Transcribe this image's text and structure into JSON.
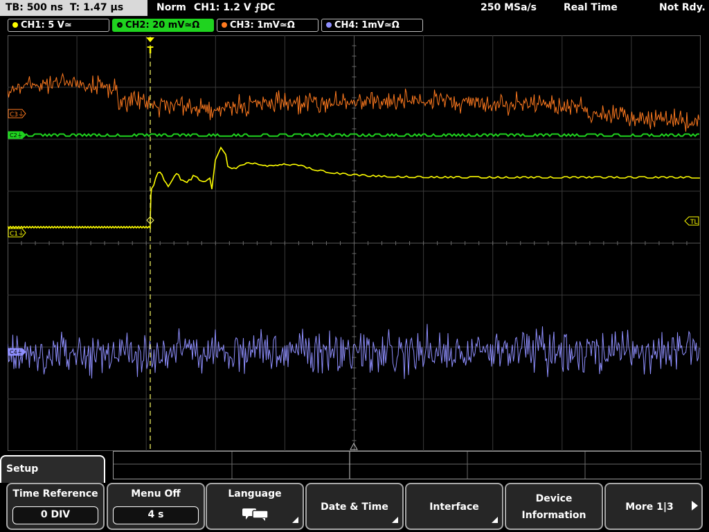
{
  "status_bar": {
    "timebase": "TB: 500 ns",
    "trigger_time": "T: 1.47 µs",
    "mode": "Norm",
    "trigger_info": "CH1: 1.2 V ⨍DC",
    "sample_rate": "250 MSa/s",
    "acq_mode": "Real Time",
    "state": "Not Rdy."
  },
  "channels": [
    {
      "label": "CH1: 5 V≃",
      "color": "#ffff00",
      "active": false
    },
    {
      "label": "CH2: 20 mV≃Ω",
      "color": "#00e000",
      "active": true
    },
    {
      "label": "CH3: 1mV≃Ω",
      "color": "#ff7a1f",
      "active": false
    },
    {
      "label": "CH4: 1mV≃Ω",
      "color": "#8f8fff",
      "active": false
    }
  ],
  "markers": {
    "c3": "C3⏚",
    "c2": "C2⏚",
    "c1": "C1⏚",
    "c4": "C4⏚",
    "trigger_level": "TL",
    "trigger_pos": "T"
  },
  "menu": {
    "title": "Setup",
    "softkeys": [
      {
        "label": "Time Reference",
        "value": "0 DIV"
      },
      {
        "label": "Menu Off",
        "value": "4 s"
      },
      {
        "label": "Language",
        "icon": "speech-bubbles-icon"
      },
      {
        "label": "Date & Time"
      },
      {
        "label": "Interface"
      },
      {
        "label_line1": "Device",
        "label_line2": "Information"
      },
      {
        "label": "More 1|3"
      }
    ]
  }
}
